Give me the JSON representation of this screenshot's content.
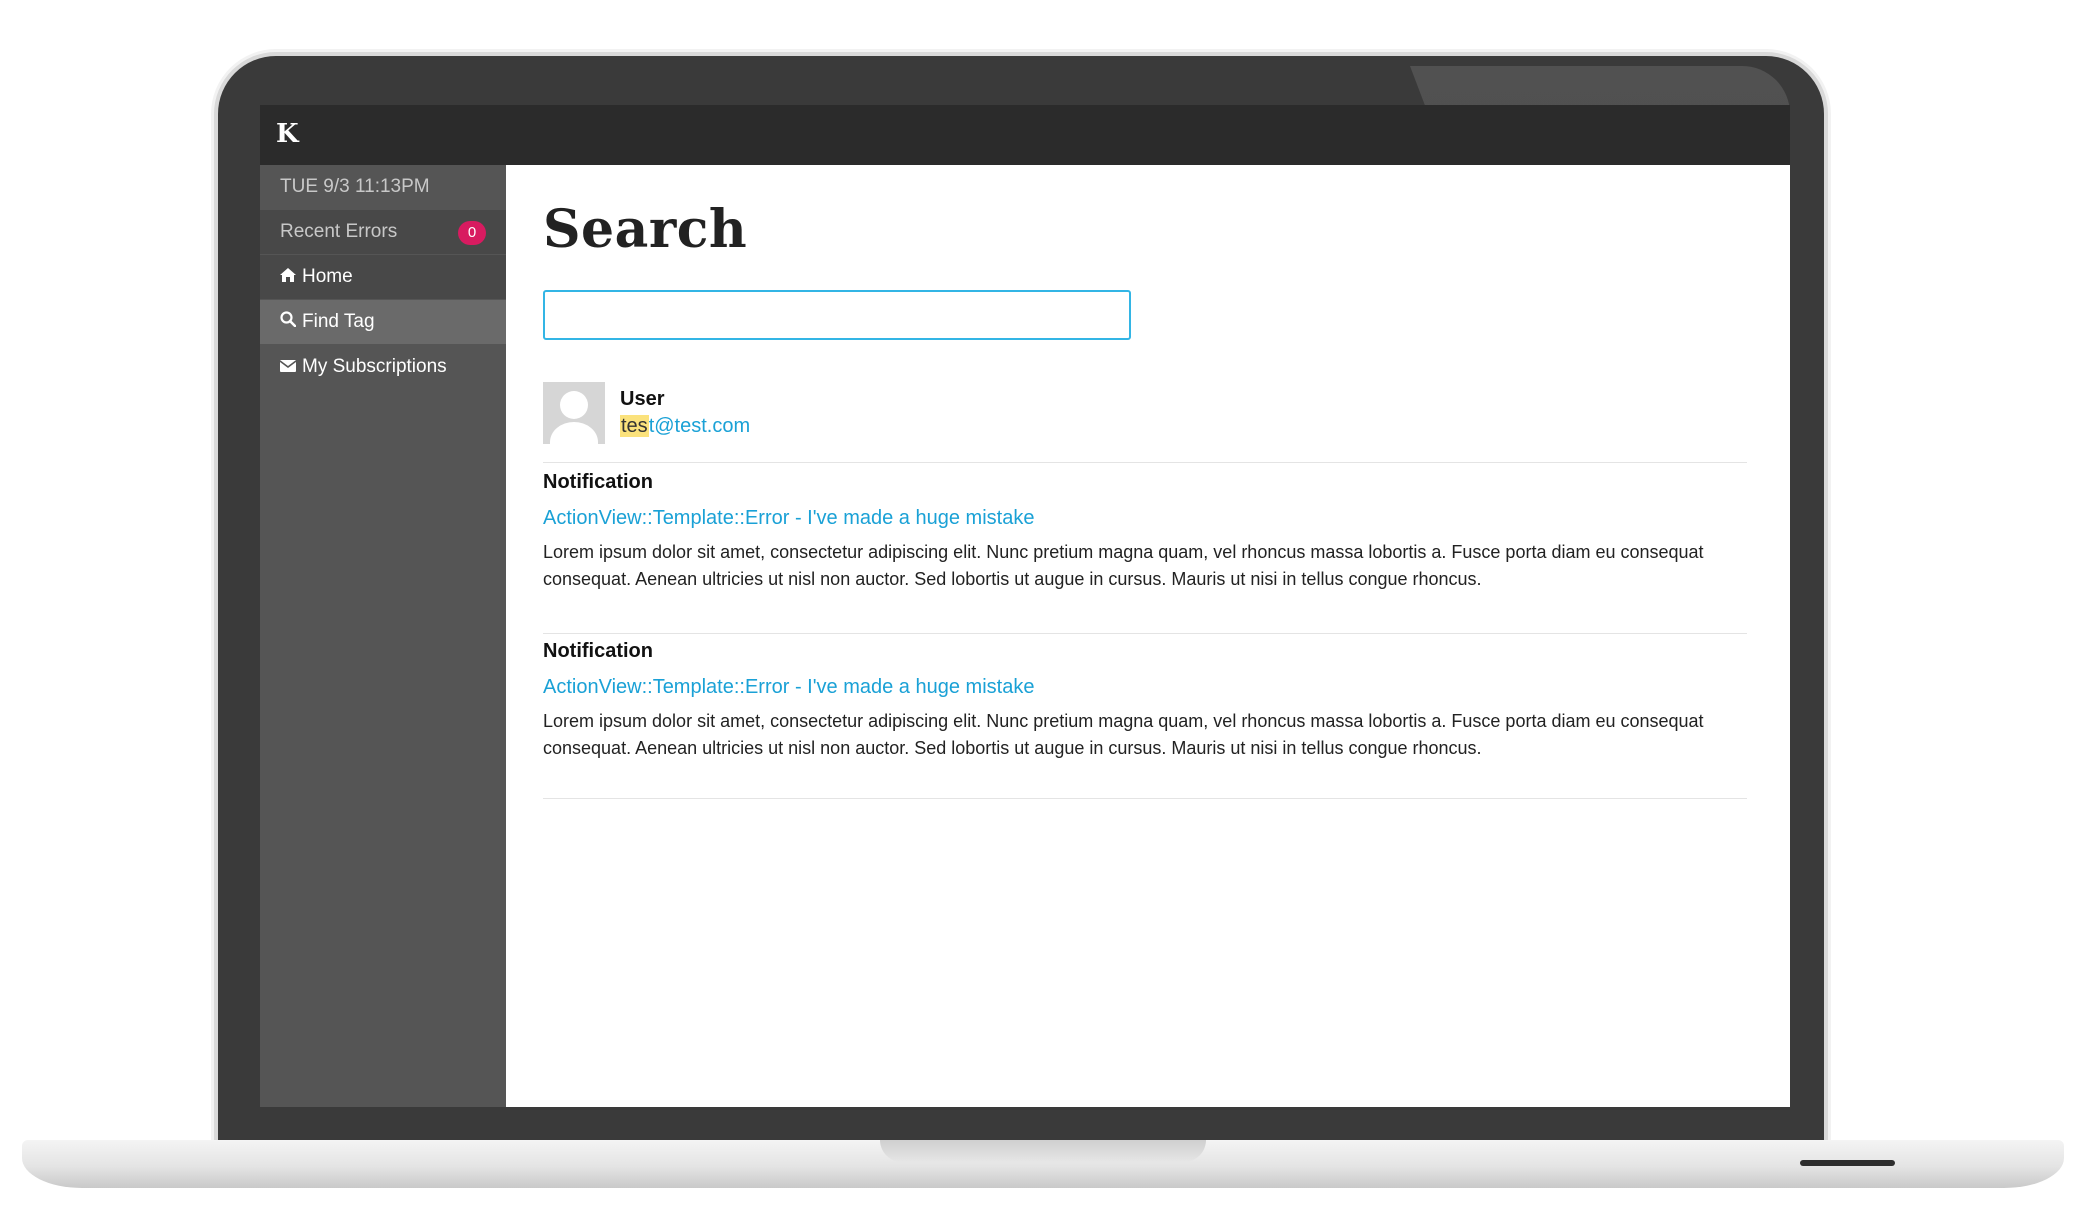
{
  "app": {
    "logo": "K",
    "clock": "TUE 9/3 11:13PM"
  },
  "sidebar": {
    "recent_errors": {
      "label": "Recent Errors",
      "count": "0",
      "badge_color": "#d81b60"
    },
    "items": [
      {
        "label": "Home",
        "icon": "home-icon",
        "active": false
      },
      {
        "label": "Find Tag",
        "icon": "search-icon",
        "active": true
      },
      {
        "label": "My Subscriptions",
        "icon": "envelope-icon",
        "active": false
      }
    ]
  },
  "main": {
    "title": "Search",
    "search": {
      "value": "",
      "placeholder": ""
    },
    "user_result": {
      "type": "User",
      "email_highlight": "tes",
      "email_rest": "t@test.com"
    },
    "results": [
      {
        "type": "Notification",
        "link": "ActionView::Template::Error - I've made a huge mistake",
        "description": "Lorem ipsum dolor sit amet, consectetur adipiscing elit. Nunc pretium magna quam, vel rhoncus massa lobortis a. Fusce porta diam eu consequat consequat. Aenean ultricies ut nisl non auctor. Sed lobortis ut augue in cursus. Mauris ut nisi in tellus congue rhoncus."
      },
      {
        "type": "Notification",
        "link": "ActionView::Template::Error - I've made a huge mistake",
        "description": "Lorem ipsum dolor sit amet, consectetur adipiscing elit. Nunc pretium magna quam, vel rhoncus massa lobortis a. Fusce porta diam eu consequat consequat. Aenean ultricies ut nisl non auctor. Sed lobortis ut augue in cursus. Mauris ut nisi in tellus congue rhoncus."
      }
    ]
  },
  "colors": {
    "accent": "#1aa1d6",
    "input_border": "#33b5e5",
    "highlight": "#fbe27c",
    "sidebar": "#555555",
    "topbar": "#2b2b2b"
  }
}
